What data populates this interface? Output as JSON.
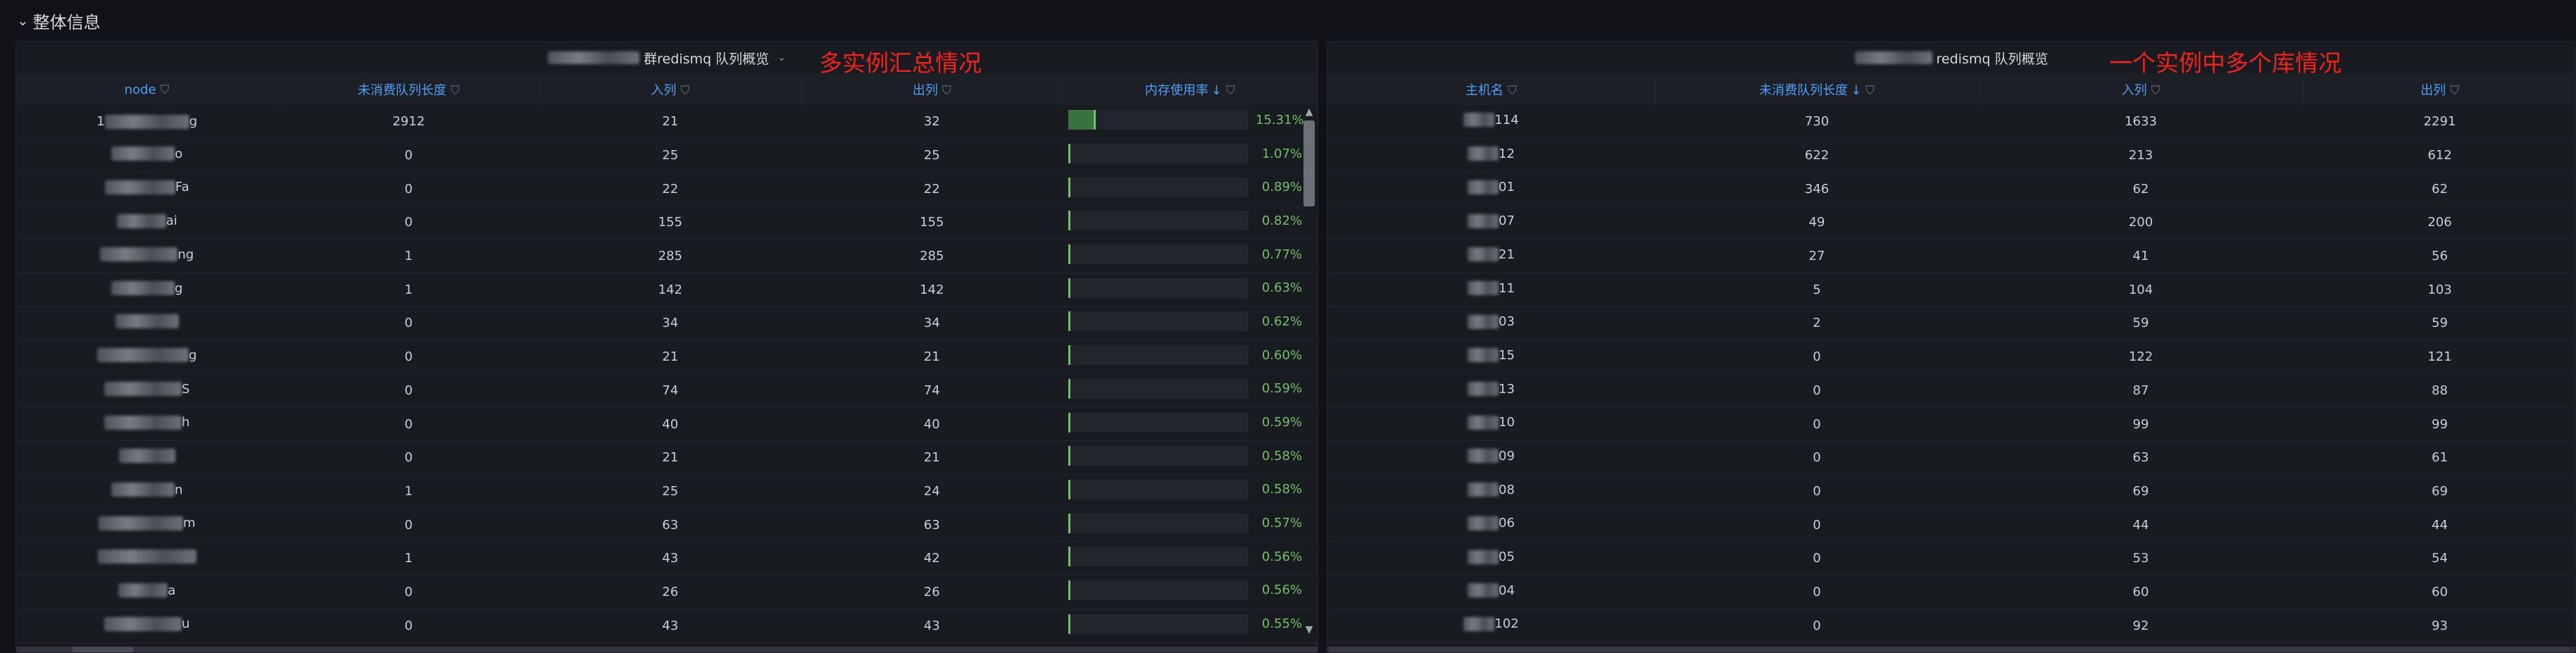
{
  "row": {
    "title": "整体信息"
  },
  "left_panel": {
    "title_prefix_blurred": true,
    "title": "群redismq 队列概览",
    "annotation": "多实例汇总情况",
    "columns": [
      {
        "label": "node",
        "sort": "",
        "filter": true
      },
      {
        "label": "未消费队列长度",
        "sort": "",
        "filter": true
      },
      {
        "label": "入列",
        "sort": "",
        "filter": true
      },
      {
        "label": "出列",
        "sort": "",
        "filter": true
      },
      {
        "label": "内存使用率",
        "sort": "↓",
        "filter": true
      }
    ],
    "rows": [
      {
        "node_prefix": "1",
        "node_suffix": "g",
        "pending": "2912",
        "in": "21",
        "out": "32",
        "mem": "15.31%",
        "mem_frac": 0.1531
      },
      {
        "node_prefix": "",
        "node_suffix": "o",
        "pending": "0",
        "in": "25",
        "out": "25",
        "mem": "1.07%",
        "mem_frac": 0.0107
      },
      {
        "node_prefix": "",
        "node_suffix": "Fa",
        "pending": "0",
        "in": "22",
        "out": "22",
        "mem": "0.89%",
        "mem_frac": 0.0089
      },
      {
        "node_prefix": "",
        "node_suffix": "ai",
        "pending": "0",
        "in": "155",
        "out": "155",
        "mem": "0.82%",
        "mem_frac": 0.0082
      },
      {
        "node_prefix": "",
        "node_suffix": "ng",
        "pending": "1",
        "in": "285",
        "out": "285",
        "mem": "0.77%",
        "mem_frac": 0.0077
      },
      {
        "node_prefix": "",
        "node_suffix": "g",
        "pending": "1",
        "in": "142",
        "out": "142",
        "mem": "0.63%",
        "mem_frac": 0.0063
      },
      {
        "node_prefix": "",
        "node_suffix": "",
        "pending": "0",
        "in": "34",
        "out": "34",
        "mem": "0.62%",
        "mem_frac": 0.0062
      },
      {
        "node_prefix": "",
        "node_suffix": "g",
        "pending": "0",
        "in": "21",
        "out": "21",
        "mem": "0.60%",
        "mem_frac": 0.006
      },
      {
        "node_prefix": "",
        "node_suffix": "S",
        "pending": "0",
        "in": "74",
        "out": "74",
        "mem": "0.59%",
        "mem_frac": 0.0059
      },
      {
        "node_prefix": "",
        "node_suffix": "h",
        "pending": "0",
        "in": "40",
        "out": "40",
        "mem": "0.59%",
        "mem_frac": 0.0059
      },
      {
        "node_prefix": "",
        "node_suffix": "",
        "pending": "0",
        "in": "21",
        "out": "21",
        "mem": "0.58%",
        "mem_frac": 0.0058
      },
      {
        "node_prefix": "",
        "node_suffix": "n",
        "pending": "1",
        "in": "25",
        "out": "24",
        "mem": "0.58%",
        "mem_frac": 0.0058
      },
      {
        "node_prefix": "",
        "node_suffix": "m",
        "pending": "0",
        "in": "63",
        "out": "63",
        "mem": "0.57%",
        "mem_frac": 0.0057
      },
      {
        "node_prefix": "",
        "node_suffix": "",
        "pending": "1",
        "in": "43",
        "out": "42",
        "mem": "0.56%",
        "mem_frac": 0.0056
      },
      {
        "node_prefix": "",
        "node_suffix": "a",
        "pending": "0",
        "in": "26",
        "out": "26",
        "mem": "0.56%",
        "mem_frac": 0.0056
      },
      {
        "node_prefix": "",
        "node_suffix": "u",
        "pending": "0",
        "in": "43",
        "out": "43",
        "mem": "0.55%",
        "mem_frac": 0.0055
      }
    ]
  },
  "right_panel": {
    "title": "redismq 队列概览",
    "annotation": "一个实例中多个库情况",
    "columns": [
      {
        "label": "主机名",
        "sort": "",
        "filter": true
      },
      {
        "label": "未消费队列长度",
        "sort": "↓",
        "filter": true
      },
      {
        "label": "入列",
        "sort": "",
        "filter": true
      },
      {
        "label": "出列",
        "sort": "",
        "filter": true
      }
    ],
    "rows": [
      {
        "host": "114",
        "pending": "730",
        "in": "1633",
        "out": "2291"
      },
      {
        "host": "12",
        "pending": "622",
        "in": "213",
        "out": "612"
      },
      {
        "host": "01",
        "pending": "346",
        "in": "62",
        "out": "62"
      },
      {
        "host": "07",
        "pending": "49",
        "in": "200",
        "out": "206"
      },
      {
        "host": "21",
        "pending": "27",
        "in": "41",
        "out": "56"
      },
      {
        "host": "11",
        "pending": "5",
        "in": "104",
        "out": "103"
      },
      {
        "host": "03",
        "pending": "2",
        "in": "59",
        "out": "59"
      },
      {
        "host": "15",
        "pending": "0",
        "in": "122",
        "out": "121"
      },
      {
        "host": "13",
        "pending": "0",
        "in": "87",
        "out": "88"
      },
      {
        "host": "10",
        "pending": "0",
        "in": "99",
        "out": "99"
      },
      {
        "host": "09",
        "pending": "0",
        "in": "63",
        "out": "61"
      },
      {
        "host": "08",
        "pending": "0",
        "in": "69",
        "out": "69"
      },
      {
        "host": "06",
        "pending": "0",
        "in": "44",
        "out": "44"
      },
      {
        "host": "05",
        "pending": "0",
        "in": "53",
        "out": "54"
      },
      {
        "host": "04",
        "pending": "0",
        "in": "60",
        "out": "60"
      },
      {
        "host": "102",
        "pending": "0",
        "in": "92",
        "out": "93"
      }
    ]
  },
  "icons": {
    "collapse": "chevron-down-icon",
    "filter": "funnel-icon",
    "menu": "caret-down-icon"
  }
}
